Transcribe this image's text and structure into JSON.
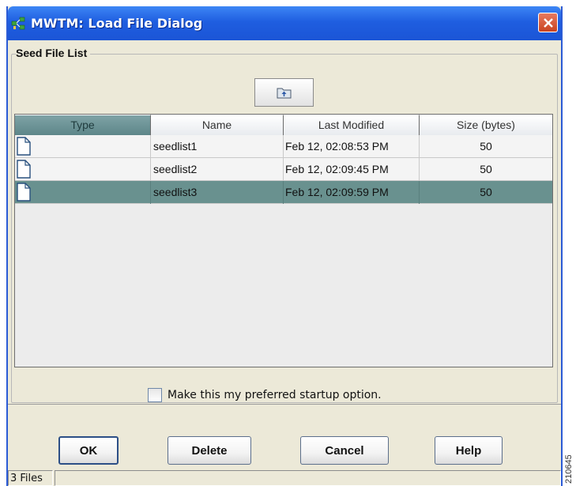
{
  "window": {
    "title": "MWTM: Load File Dialog"
  },
  "group": {
    "title": "Seed File List"
  },
  "table": {
    "columns": [
      "Type",
      "Name",
      "Last Modified",
      "Size (bytes)"
    ],
    "sorted_column": "Type",
    "rows": [
      {
        "type_icon": "file-icon",
        "name": "seedlist1",
        "modified": "Feb 12, 02:08:53 PM",
        "size": "50",
        "selected": false
      },
      {
        "type_icon": "file-icon",
        "name": "seedlist2",
        "modified": "Feb 12, 02:09:45 PM",
        "size": "50",
        "selected": false
      },
      {
        "type_icon": "file-icon",
        "name": "seedlist3",
        "modified": "Feb 12, 02:09:59 PM",
        "size": "50",
        "selected": true
      }
    ]
  },
  "preference": {
    "label": "Make this my preferred startup option.",
    "checked": false
  },
  "buttons": {
    "ok": "OK",
    "delete": "Delete",
    "cancel": "Cancel",
    "help": "Help"
  },
  "status": {
    "file_count": "3 Files",
    "message": ""
  },
  "figure_id": "210645",
  "colors": {
    "title_bar": "#1f5ee0",
    "selected_row": "#69918f",
    "sorted_header": "#6e9497",
    "dialog_bg": "#ece9d8"
  }
}
